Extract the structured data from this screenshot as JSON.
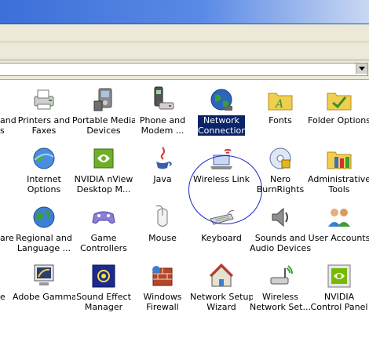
{
  "address": {
    "value": ""
  },
  "items": [
    {
      "line1": "and",
      "line2": "s",
      "icon": "printer-icon"
    },
    {
      "line1": "Printers and",
      "line2": "Faxes",
      "icon": "printer-fax-icon"
    },
    {
      "line1": "Portable Media",
      "line2": "Devices",
      "icon": "media-device-icon"
    },
    {
      "line1": "Phone and",
      "line2": "Modem ...",
      "icon": "phone-modem-icon"
    },
    {
      "line1": "Network",
      "line2": "Connections",
      "icon": "network-globe-icon",
      "selected": true
    },
    {
      "line1": "Fonts",
      "line2": "",
      "icon": "fonts-folder-icon"
    },
    {
      "line1": "Folder Options",
      "line2": "",
      "icon": "folder-options-icon"
    },
    {
      "line1": "Internet",
      "line2": "Options",
      "icon": "internet-globe-icon"
    },
    {
      "line1": "NVIDIA nView",
      "line2": "Desktop M...",
      "icon": "nvidia-nview-icon"
    },
    {
      "line1": "Java",
      "line2": "",
      "icon": "java-icon"
    },
    {
      "line1": "Wireless Link",
      "line2": "",
      "icon": "wireless-link-icon"
    },
    {
      "line1": "Nero",
      "line2": "BurnRights",
      "icon": "nero-disc-icon"
    },
    {
      "line1": "Administrative",
      "line2": "Tools",
      "icon": "admin-tools-icon"
    },
    {
      "line1": "are",
      "line2": "",
      "icon": "software-icon"
    },
    {
      "line1": "Regional and",
      "line2": "Language ...",
      "icon": "regional-globe-icon"
    },
    {
      "line1": "Game",
      "line2": "Controllers",
      "icon": "gamepad-icon"
    },
    {
      "line1": "Mouse",
      "line2": "",
      "icon": "mouse-icon"
    },
    {
      "line1": "Keyboard",
      "line2": "",
      "icon": "keyboard-icon"
    },
    {
      "line1": "Sounds and",
      "line2": "Audio Devices",
      "icon": "speaker-icon"
    },
    {
      "line1": "User Accounts",
      "line2": "",
      "icon": "user-accounts-icon"
    },
    {
      "line1": "e",
      "line2": "",
      "icon": "misc-icon"
    },
    {
      "line1": "Adobe Gamma",
      "line2": "",
      "icon": "adobe-gamma-icon"
    },
    {
      "line1": "Sound Effect",
      "line2": "Manager",
      "icon": "sound-effect-icon"
    },
    {
      "line1": "Windows",
      "line2": "Firewall",
      "icon": "firewall-icon"
    },
    {
      "line1": "Network Setup",
      "line2": "Wizard",
      "icon": "network-setup-house-icon"
    },
    {
      "line1": "Wireless",
      "line2": "Network Set...",
      "icon": "wireless-network-icon"
    },
    {
      "line1": "NVIDIA",
      "line2": "Control Panel",
      "icon": "nvidia-control-panel-icon"
    }
  ]
}
